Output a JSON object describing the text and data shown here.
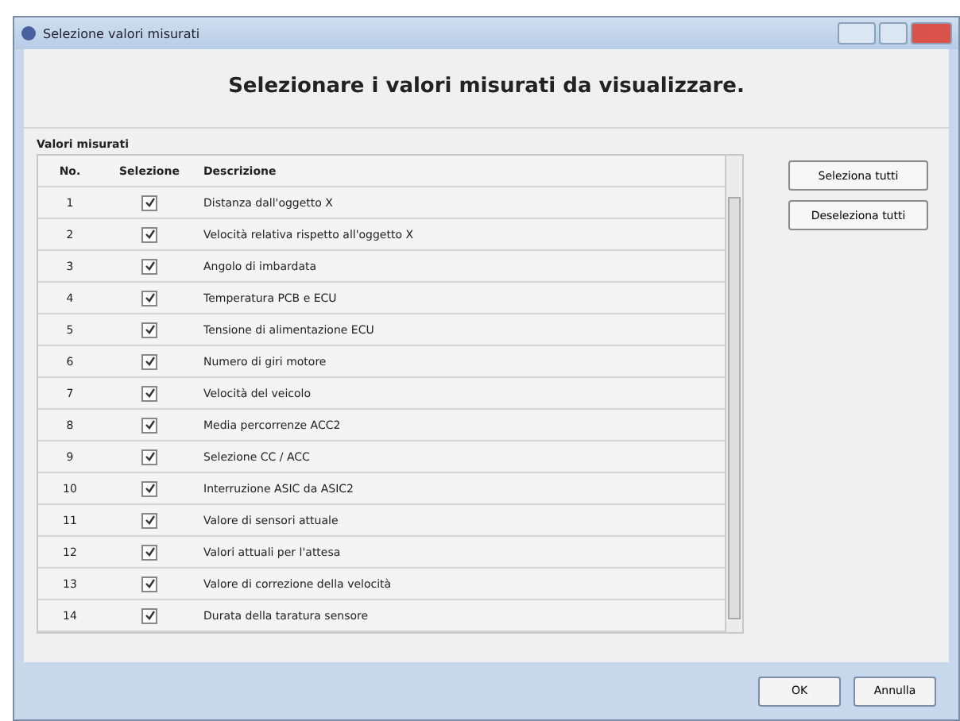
{
  "window": {
    "title": "Selezione valori misurati"
  },
  "heading": "Selezionare i valori misurati da visualizzare.",
  "group": {
    "label": "Valori misurati",
    "columns": [
      "No.",
      "Selezione",
      "Descrizione"
    ],
    "rows": [
      {
        "no": "1",
        "checked": true,
        "description": "Distanza dall'oggetto X"
      },
      {
        "no": "2",
        "checked": true,
        "description": "Velocità relativa rispetto all'oggetto X"
      },
      {
        "no": "3",
        "checked": true,
        "description": "Angolo di imbardata"
      },
      {
        "no": "4",
        "checked": true,
        "description": "Temperatura PCB e ECU"
      },
      {
        "no": "5",
        "checked": true,
        "description": "Tensione di alimentazione ECU"
      },
      {
        "no": "6",
        "checked": true,
        "description": "Numero di giri motore"
      },
      {
        "no": "7",
        "checked": true,
        "description": "Velocità del veicolo"
      },
      {
        "no": "8",
        "checked": true,
        "description": "Media percorrenze ACC2"
      },
      {
        "no": "9",
        "checked": true,
        "description": "Selezione CC / ACC"
      },
      {
        "no": "10",
        "checked": true,
        "description": "Interruzione ASIC da ASIC2"
      },
      {
        "no": "11",
        "checked": true,
        "description": "Valore di sensori attuale"
      },
      {
        "no": "12",
        "checked": true,
        "description": "Valori attuali per l'attesa"
      },
      {
        "no": "13",
        "checked": true,
        "description": "Valore di correzione della velocità"
      },
      {
        "no": "14",
        "checked": true,
        "description": "Durata della taratura sensore"
      }
    ]
  },
  "side_buttons": [
    "Seleziona tutti",
    "Deseleziona tutti"
  ],
  "footer_buttons": [
    "OK",
    "Annulla"
  ]
}
